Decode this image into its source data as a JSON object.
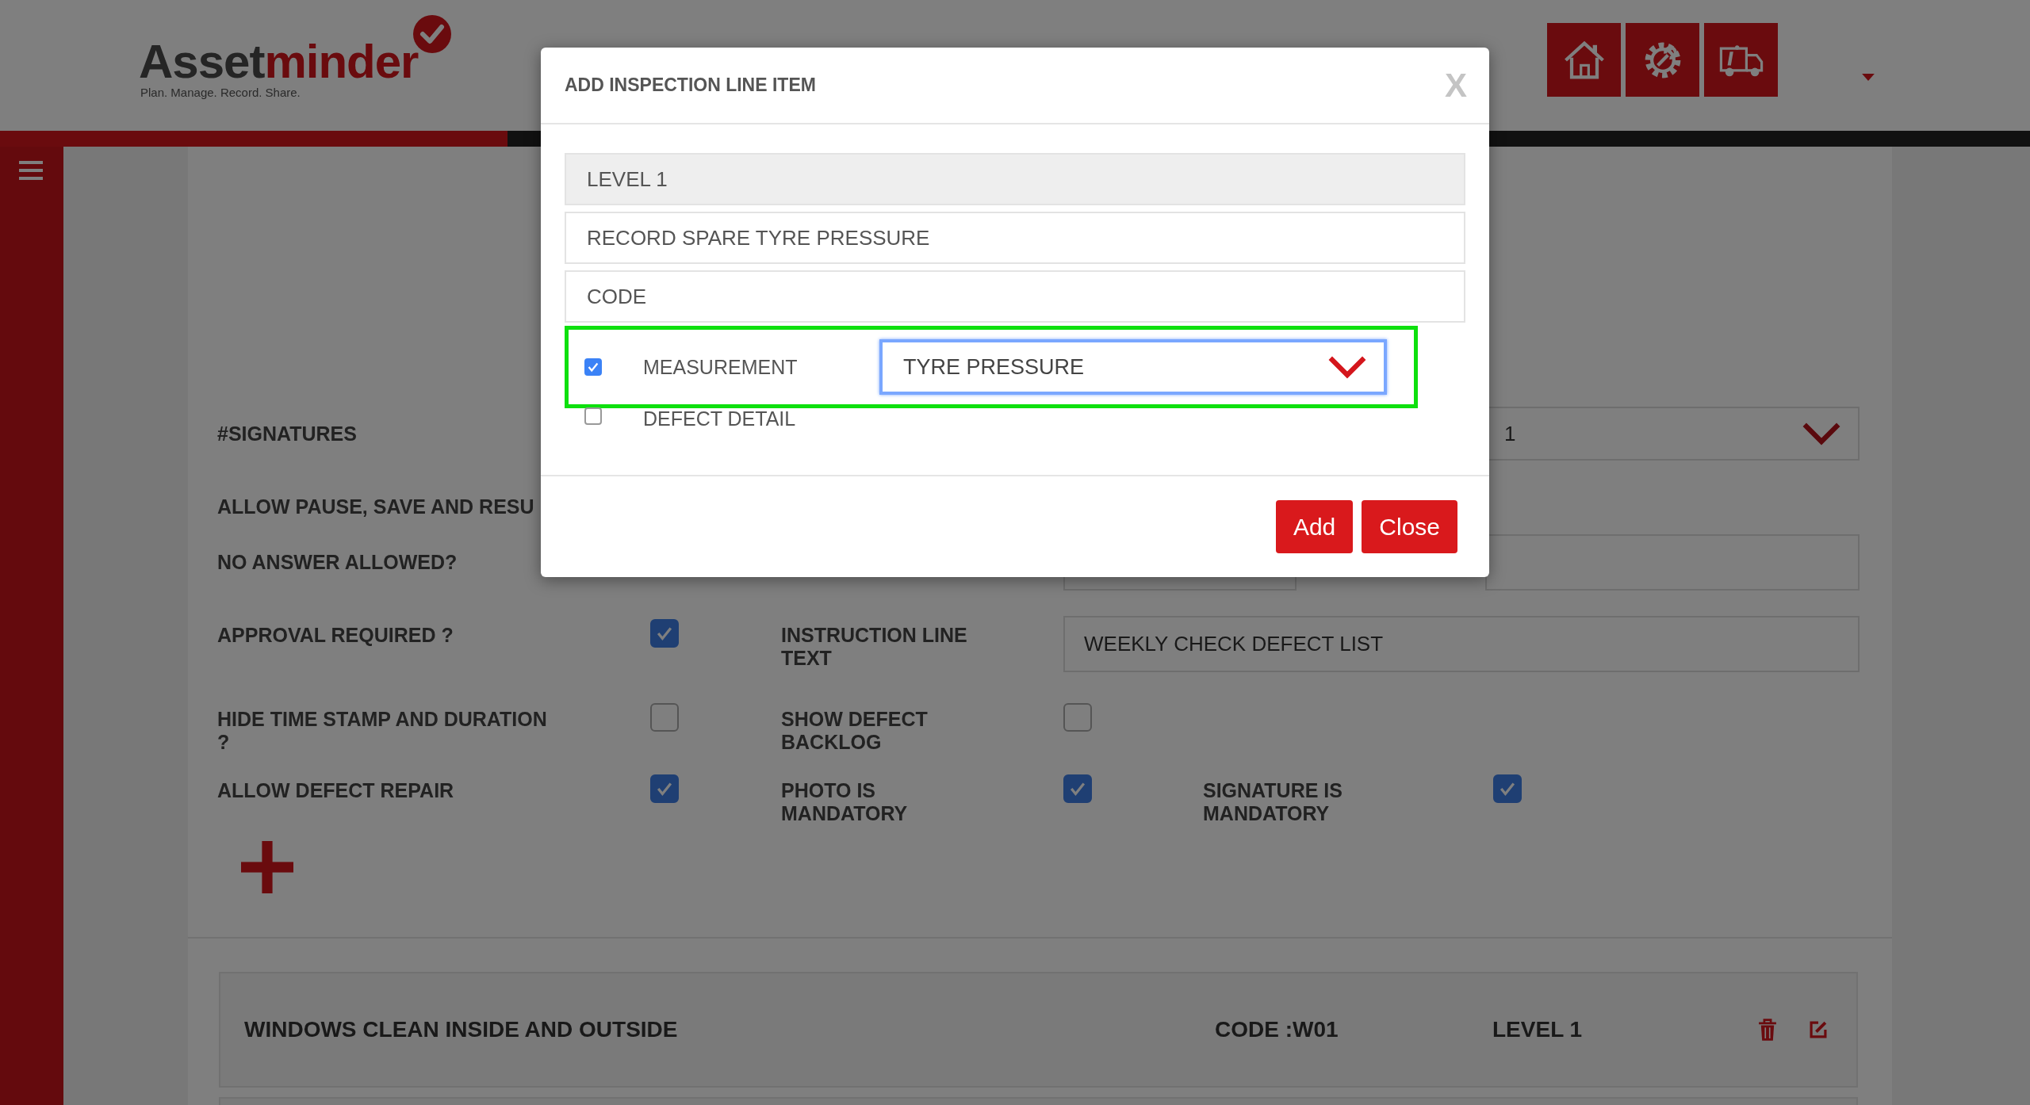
{
  "header": {
    "logo": {
      "name_start": "Asset",
      "name_end": "minder",
      "tagline": "Plan. Manage. Record. Share."
    },
    "toolbar_icons": [
      {
        "kind": "home"
      },
      {
        "kind": "gear"
      },
      {
        "kind": "truck"
      }
    ],
    "progress": {
      "level": 0.25
    }
  },
  "form": {
    "signatures": {
      "label": "#SIGNATURES",
      "value": "1"
    },
    "pause_label": "ALLOW PAUSE, SAVE AND RESU",
    "no_answer_label": "NO ANSWER ALLOWED?",
    "rows": [
      [
        {
          "kind": "checkbox",
          "label": "APPROVAL REQUIRED ?",
          "checked": true
        },
        {
          "kind": "text",
          "label": "INSTRUCTION LINE TEXT",
          "value": "WEEKLY CHECK DEFECT LIST"
        }
      ],
      [
        {
          "kind": "checkbox",
          "label": "HIDE TIME STAMP AND DURATION ?",
          "checked": false
        },
        {
          "kind": "checkbox",
          "label": "SHOW DEFECT BACKLOG",
          "checked": false
        }
      ],
      [
        {
          "kind": "checkbox",
          "label": "ALLOW DEFECT REPAIR",
          "checked": true
        },
        {
          "kind": "checkbox",
          "label": "PHOTO IS MANDATORY",
          "checked": true
        },
        {
          "kind": "checkbox",
          "label": "SIGNATURE IS MANDATORY",
          "checked": true
        }
      ]
    ]
  },
  "line_items": [
    {
      "title": "WINDOWS CLEAN INSIDE AND OUTSIDE",
      "code": "CODE :W01",
      "level_label": "LEVEL 1"
    }
  ],
  "dialog": {
    "title": "ADD INSPECTION LINE ITEM",
    "close": "X",
    "fields": [
      {
        "value": "LEVEL 1",
        "disabled": true
      },
      {
        "value": "RECORD SPARE TYRE PRESSURE",
        "disabled": false
      },
      {
        "placeholder": "CODE",
        "disabled": false
      }
    ],
    "options": [
      {
        "label": "MEASUREMENT",
        "checked": true,
        "highlighted": true,
        "select": {
          "value": "TYRE PRESSURE",
          "focused": true
        }
      },
      {
        "label": "DEFECT DETAIL",
        "checked": false,
        "highlighted": false
      }
    ],
    "buttons": [
      {
        "label": "Add"
      },
      {
        "label": "Close"
      }
    ]
  }
}
